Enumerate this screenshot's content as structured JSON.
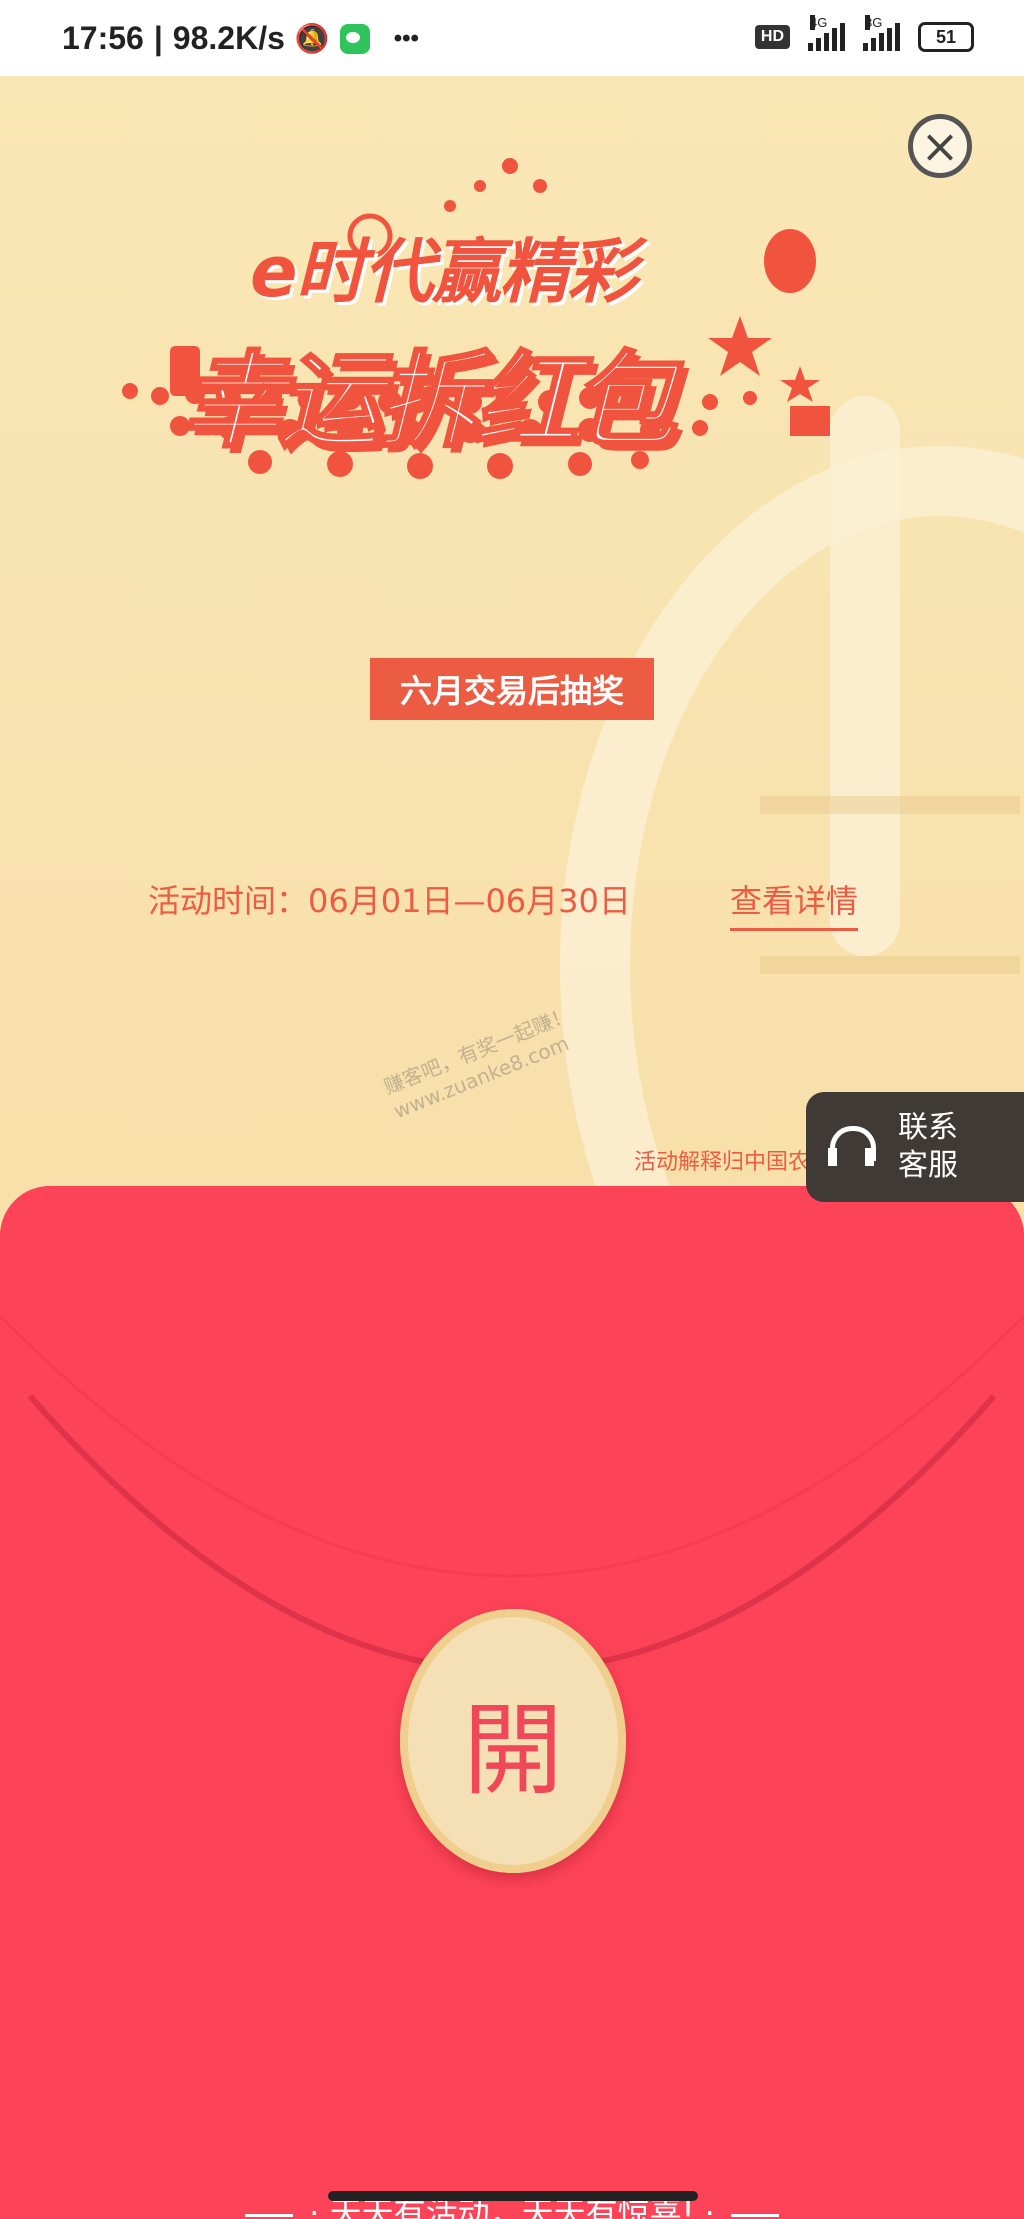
{
  "status_bar": {
    "time": "17:56",
    "separator": "|",
    "speed": "98.2K/s",
    "more": "•••",
    "hd": "HD",
    "net1": "4G",
    "net2": "3G",
    "battery": "51"
  },
  "close_button": {
    "icon": "close-icon"
  },
  "banner": {
    "line1": "e时代赢精彩",
    "line2": "幸运拆红包"
  },
  "badge": "六月交易后抽奖",
  "activity": {
    "time_text": "活动时间：06月01日—06月30日",
    "detail_link": "查看详情"
  },
  "legal_text": "活动解释归中国农业银行",
  "watermark": {
    "line1": "赚客吧，有奖一起赚！",
    "line2": "www.zuanke8.com"
  },
  "customer_service": {
    "line1": "联系",
    "line2": "客服",
    "icon": "headset-icon"
  },
  "open_button": {
    "label": "開"
  },
  "slogan": "· 天天有活动，天天有惊喜! ·",
  "colors": {
    "accent": "#ec5c43",
    "envelope": "#fd4358",
    "background": "#f8e1ad",
    "gold": "#f5e0b5"
  }
}
